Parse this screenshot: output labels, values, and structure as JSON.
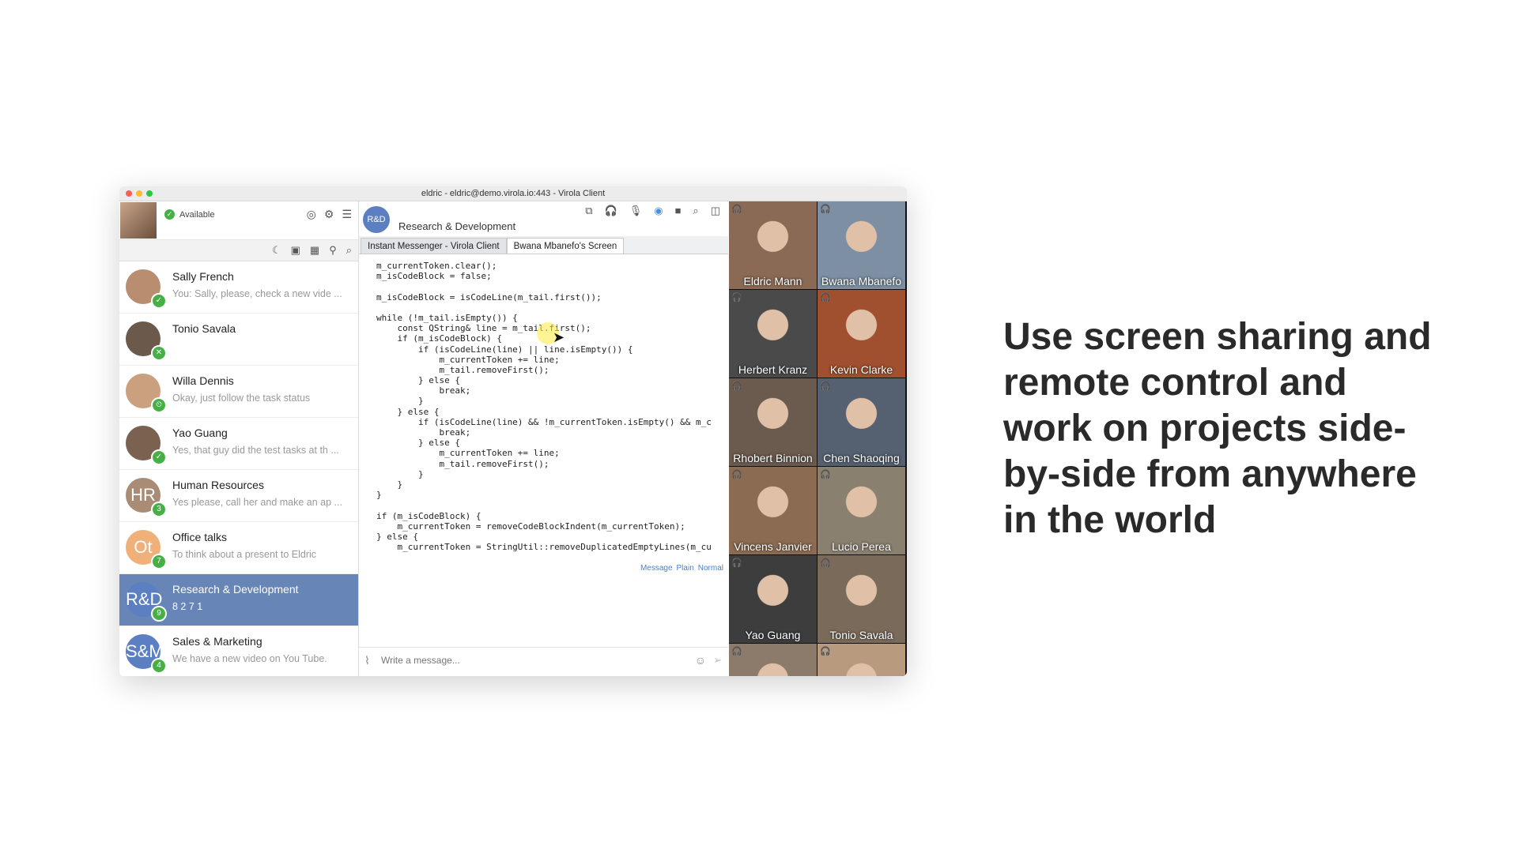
{
  "window": {
    "title": "eldric - eldric@demo.virola.io:443 - Virola Client"
  },
  "me": {
    "status": "Available"
  },
  "contacts": [
    {
      "initials": "",
      "name": "Sally French",
      "msg": "You: Sally, please, check a new vide ...",
      "badge": "✓",
      "color": "#b98d6f"
    },
    {
      "initials": "",
      "name": "Tonio Savala",
      "msg": "",
      "badge": "✕",
      "color": "#6b5a4b"
    },
    {
      "initials": "",
      "name": "Willa Dennis",
      "msg": "Okay, just follow the task status",
      "badge": "⏲",
      "color": "#caa07f"
    },
    {
      "initials": "",
      "name": "Yao Guang",
      "msg": "Yes, that guy did the test tasks at th ...",
      "badge": "✓",
      "color": "#7a6150"
    },
    {
      "initials": "HR",
      "name": "Human Resources",
      "msg": "Yes please, call her and make an ap ...",
      "badge": "3",
      "color": "#a98c76"
    },
    {
      "initials": "Ot",
      "name": "Office talks",
      "msg": "To think about a present to Eldric",
      "badge": "7",
      "color": "#efb07a"
    },
    {
      "initials": "R&D",
      "name": "Research & Development",
      "msg": "8  2  7  1",
      "badge": "9",
      "color": "#5b7fc1",
      "active": true
    },
    {
      "initials": "S&M",
      "name": "Sales & Marketing",
      "msg": "We have a new video on You Tube.",
      "badge": "4",
      "color": "#5b7fc1"
    }
  ],
  "chat": {
    "avatar": "R&D",
    "title": "Research & Development",
    "tabs": [
      "Instant Messenger - Virola Client",
      "Bwana Mbanefo's Screen"
    ],
    "format": [
      "Message",
      "Plain",
      "Normal"
    ],
    "placeholder": "Write a message..."
  },
  "code_lines": [
    "m_currentToken.clear();",
    "m_isCodeBlock = false;",
    "",
    "m_isCodeBlock = isCodeLine(m_tail.first());",
    "",
    "while (!m_tail.isEmpty()) {",
    "    const QString& line = m_tail.first();",
    "    if (m_isCodeBlock) {",
    "        if (isCodeLine(line) || line.isEmpty()) {",
    "            m_currentToken += line;",
    "            m_tail.removeFirst();",
    "        } else {",
    "            break;",
    "        }",
    "    } else {",
    "        if (isCodeLine(line) && !m_currentToken.isEmpty() && m_c",
    "            break;",
    "        } else {",
    "            m_currentToken += line;",
    "            m_tail.removeFirst();",
    "        }",
    "    }",
    "}",
    "",
    "if (m_isCodeBlock) {",
    "    m_currentToken = removeCodeBlockIndent(m_currentToken);",
    "} else {",
    "    m_currentToken = StringUtil::removeDuplicatedEmptyLines(m_cu"
  ],
  "participants": [
    {
      "name": "Eldric Mann",
      "color": "#8a6a55"
    },
    {
      "name": "Bwana Mbanefo",
      "color": "#7d8fa3"
    },
    {
      "name": "Herbert Kranz",
      "color": "#4a4a4a"
    },
    {
      "name": "Kevin Clarke",
      "color": "#a0502f"
    },
    {
      "name": "Rhobert Binnion",
      "color": "#6b5a4e"
    },
    {
      "name": "Chen Shaoqing",
      "color": "#556070"
    },
    {
      "name": "Vincens Janvier",
      "color": "#8b6b52"
    },
    {
      "name": "Lucio Perea",
      "color": "#8a8070"
    },
    {
      "name": "Yao Guang",
      "color": "#3d3d3d"
    },
    {
      "name": "Tonio Savala",
      "color": "#7a6a5a"
    },
    {
      "name": "",
      "color": "#8c7a6a"
    },
    {
      "name": "",
      "color": "#b89a7f"
    }
  ],
  "headline": "Use screen sharing and remote control and work on projects side-by-side from anywhere in the world"
}
